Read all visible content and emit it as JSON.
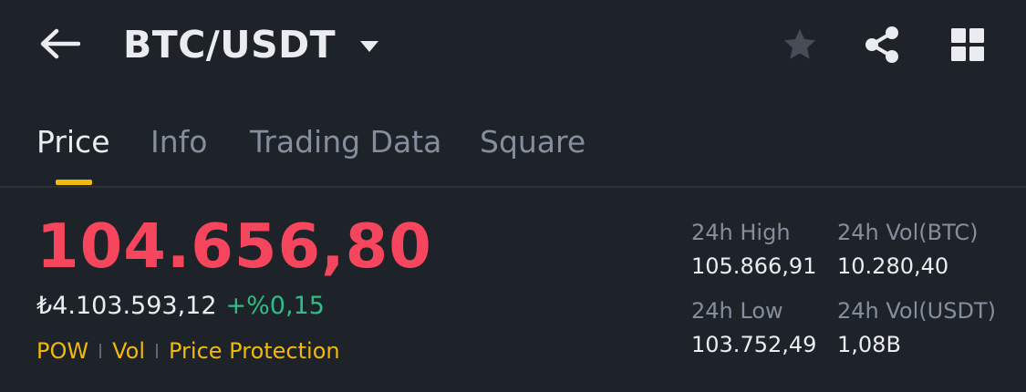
{
  "header": {
    "pair": "BTC/USDT",
    "icons": {
      "back": "back-arrow-icon",
      "caret": "caret-down-icon",
      "favorite": "star-icon",
      "share": "share-icon",
      "more": "grid-icon"
    }
  },
  "tabs": [
    {
      "label": "Price",
      "active": true
    },
    {
      "label": "Info",
      "active": false
    },
    {
      "label": "Trading Data",
      "active": false
    },
    {
      "label": "Square",
      "active": false
    }
  ],
  "price": {
    "last": "104.656,80",
    "fiat": "₺4.103.593,12",
    "change": "+%0,15",
    "tags": [
      "POW",
      "Vol",
      "Price Protection"
    ]
  },
  "stats": {
    "high_label": "24h High",
    "high_value": "105.866,91",
    "low_label": "24h Low",
    "low_value": "103.752,49",
    "vol_btc_label": "24h Vol(BTC)",
    "vol_btc_value": "10.280,40",
    "vol_usdt_label": "24h Vol(USDT)",
    "vol_usdt_value": "1,08B"
  },
  "colors": {
    "background": "#1e2329",
    "price_down": "#f6465d",
    "price_up": "#2ebd85",
    "accent": "#f0b90b",
    "text_primary": "#eaecef",
    "text_secondary": "#848e9c"
  }
}
